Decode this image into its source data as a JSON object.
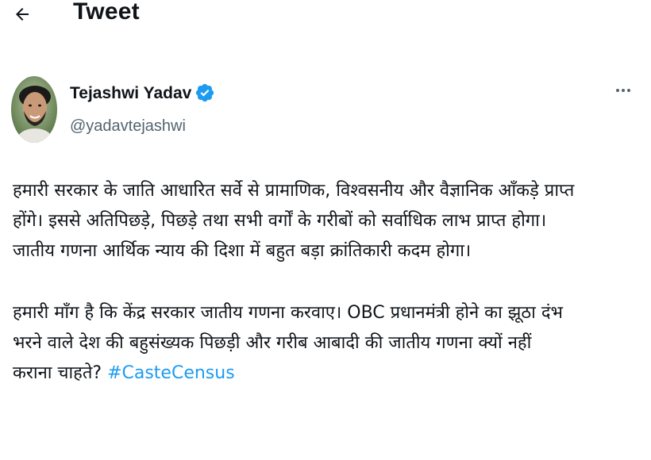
{
  "header": {
    "back_icon": "arrow-left-icon",
    "title": "Tweet"
  },
  "author": {
    "name": "Tejashwi Yadav",
    "handle": "@yadavtejashwi",
    "verified_icon": "verified-badge-icon",
    "verified_color": "#1d9bf0",
    "more_icon": "more-horizontal-icon"
  },
  "tweet": {
    "para1_line1": "हमारी सरकार के जाति आधारित सर्वे से प्रामाणिक, विश्वसनीय और वैज्ञानिक आँकड़े प्राप्त",
    "para1_line2": "होंगे। इससे अतिपिछड़े, पिछड़े तथा सभी वर्गों के गरीबों को सर्वाधिक लाभ प्राप्त होगा।",
    "para1_line3": "जातीय गणना आर्थिक न्याय की दिशा में बहुत बड़ा क्रांतिकारी कदम होगा।",
    "para2_line1": "हमारी माँग है कि केंद्र सरकार जातीय गणना करवाए। OBC प्रधानमंत्री होने का झूठा दंभ",
    "para2_line2": "भरने वाले देश की बहुसंख्यक पिछड़ी और गरीब आबादी की जातीय गणना क्यों नहीं",
    "para2_line3_prefix": "कराना चाहते?",
    "hashtag": "#CasteCensus",
    "hashtag_color": "#1d9bf0"
  }
}
